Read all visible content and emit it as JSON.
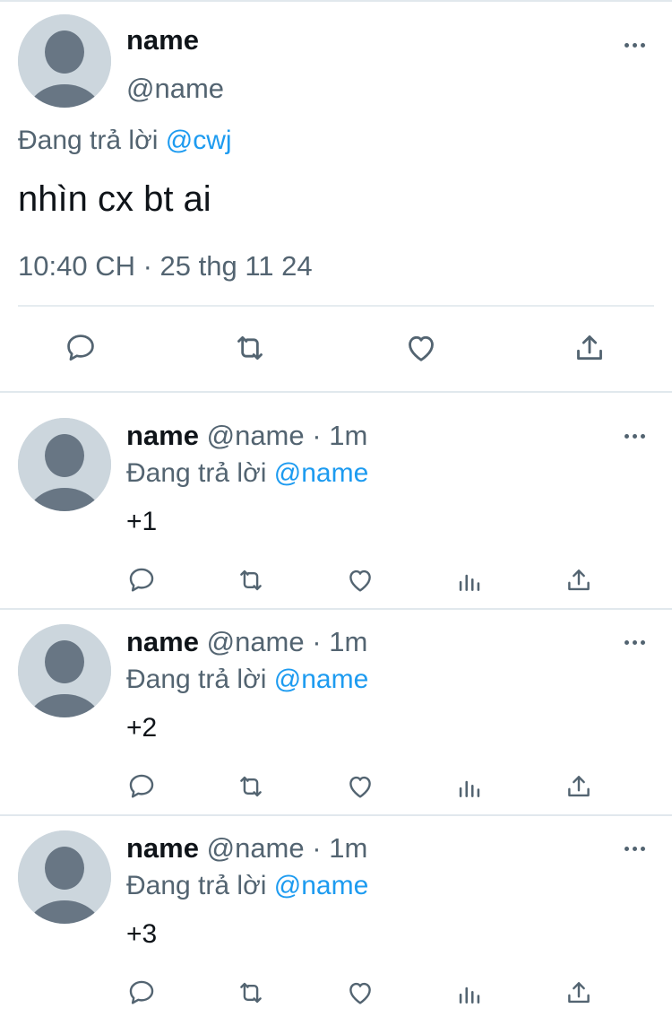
{
  "main_tweet": {
    "name": "name",
    "handle": "@name",
    "reply_prefix": "Đang trả lời",
    "reply_mention": "@cwj",
    "text": "nhìn cx bt ai",
    "timestamp": "10:40 CH · 25 thg 11 24",
    "actions": [
      "reply-icon",
      "retweet-icon",
      "like-icon",
      "share-icon"
    ]
  },
  "replies": [
    {
      "name": "name",
      "handle": "@name",
      "separator": "·",
      "time": "1m",
      "reply_prefix": "Đang trả lời",
      "reply_mention": "@name",
      "text": "+1"
    },
    {
      "name": "name",
      "handle": "@name",
      "separator": "·",
      "time": "1m",
      "reply_prefix": "Đang trả lời",
      "reply_mention": "@name",
      "text": "+2"
    },
    {
      "name": "name",
      "handle": "@name",
      "separator": "·",
      "time": "1m",
      "reply_prefix": "Đang trả lời",
      "reply_mention": "@name",
      "text": "+3"
    }
  ],
  "reply_actions": [
    "reply-icon",
    "retweet-icon",
    "like-icon",
    "views-icon",
    "share-icon"
  ],
  "colors": {
    "accent": "#1d9bf0",
    "secondary_text": "#536471",
    "avatar_bg": "#ccd6dd",
    "avatar_fg": "#687684",
    "icon": "#536471"
  }
}
